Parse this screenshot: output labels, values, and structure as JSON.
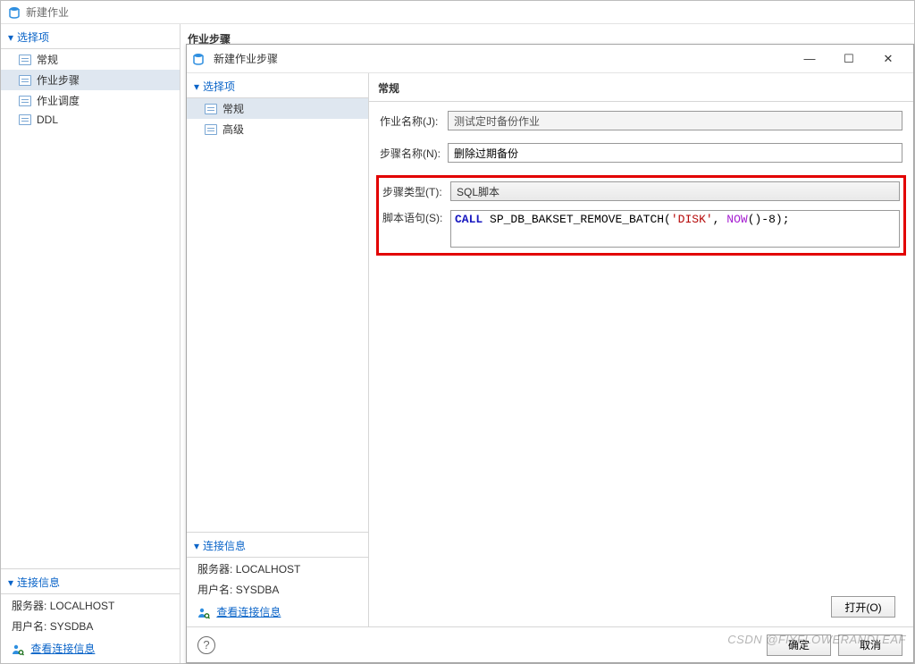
{
  "outer": {
    "title": "新建作业",
    "steps_label": "作业步骤"
  },
  "left_nav": {
    "section": "选择项",
    "items": [
      "常规",
      "作业步骤",
      "作业调度",
      "DDL"
    ],
    "selected_index": 1
  },
  "left_conn": {
    "section": "连接信息",
    "server_label": "服务器:",
    "server_value": "LOCALHOST",
    "user_label": "用户名:",
    "user_value": "SYSDBA",
    "link": "查看连接信息"
  },
  "dialog": {
    "title": "新建作业步骤",
    "win_min": "—",
    "win_max": "☐",
    "win_close": "✕",
    "left_section": "选择项",
    "left_items": [
      "常规",
      "高级"
    ],
    "left_selected_index": 0,
    "right_head": "常规",
    "form": {
      "job_label": "作业名称(J):",
      "job_value": "测试定时备份作业",
      "step_label": "步骤名称(N):",
      "step_value": "删除过期备份",
      "type_label": "步骤类型(T):",
      "type_value": "SQL脚本",
      "script_label": "脚本语句(S):",
      "script_call": "CALL",
      "script_sp": " SP_DB_BAKSET_REMOVE_BATCH(",
      "script_str": "'DISK'",
      "script_sep": ", ",
      "script_now": "NOW",
      "script_tail": "()-8);",
      "open_btn": "打开(O)"
    },
    "conn": {
      "section": "连接信息",
      "server_label": "服务器:",
      "server_value": "LOCALHOST",
      "user_label": "用户名:",
      "user_value": "SYSDBA",
      "link": "查看连接信息"
    },
    "footer": {
      "help": "?",
      "ok": "确定",
      "cancel": "取消"
    }
  },
  "watermark": "CSDN @FlYFLOWERANDLEAF"
}
